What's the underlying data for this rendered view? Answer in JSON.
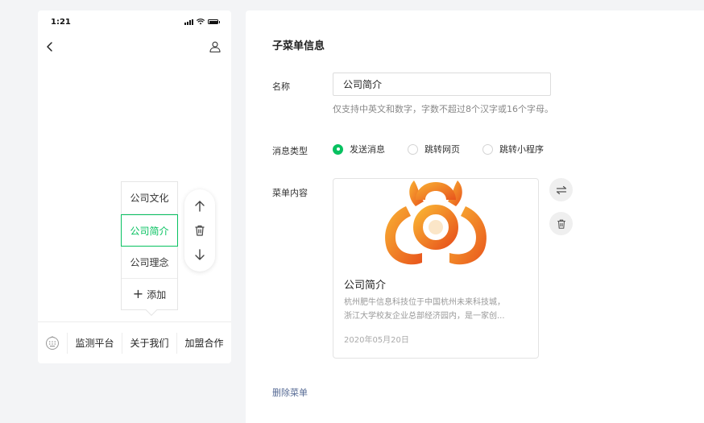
{
  "phone": {
    "status_time": "1:21",
    "submenu": {
      "items": [
        {
          "label": "公司文化",
          "active": false
        },
        {
          "label": "公司简介",
          "active": true
        },
        {
          "label": "公司理念",
          "active": false
        }
      ],
      "add_label": "添加"
    },
    "tabbar": {
      "tabs": [
        "监测平台",
        "关于我们",
        "加盟合作"
      ]
    }
  },
  "editor": {
    "section_title": "子菜单信息",
    "name": {
      "label": "名称",
      "value": "公司简介",
      "hint": "仅支持中英文和数字，字数不超过8个汉字或16个字母。"
    },
    "message_type": {
      "label": "消息类型",
      "options": [
        {
          "label": "发送消息",
          "checked": true
        },
        {
          "label": "跳转网页",
          "checked": false
        },
        {
          "label": "跳转小程序",
          "checked": false
        }
      ]
    },
    "content": {
      "label": "菜单内容",
      "article": {
        "title": "公司简介",
        "description_line1": "杭州肥牛信息科技位于中国杭州未来科技城，",
        "description_line2": "浙江大学校友企业总部经济园内，是一家创...",
        "date": "2020年05月20日"
      }
    },
    "delete_label": "删除菜单"
  },
  "colors": {
    "accent": "#07c160",
    "link": "#576b95",
    "logo_orange": "#f28a1c"
  }
}
